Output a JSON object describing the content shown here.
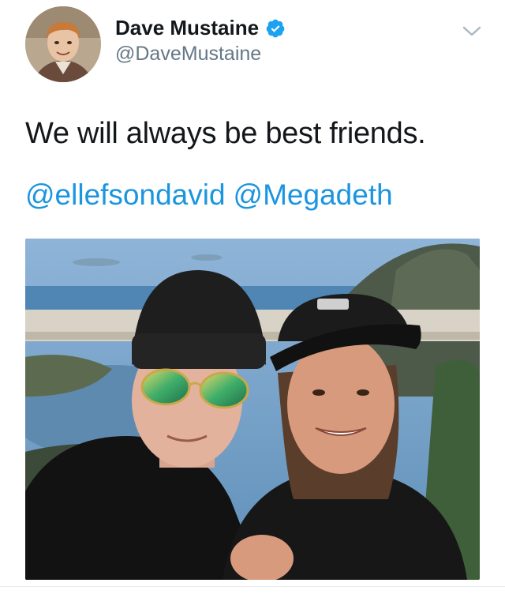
{
  "tweet": {
    "author": {
      "display_name": "Dave Mustaine",
      "handle": "@DaveMustaine",
      "verified": true
    },
    "text": "We will always be best friends.",
    "mentions": [
      "@ellefsondavid",
      "@Megadeth"
    ]
  },
  "icons": {
    "verified": "verified-badge-icon",
    "menu": "chevron-down-icon"
  },
  "colors": {
    "link": "#1b95e0",
    "handle": "#657786",
    "verified": "#1da1f2",
    "text": "#14171a"
  }
}
